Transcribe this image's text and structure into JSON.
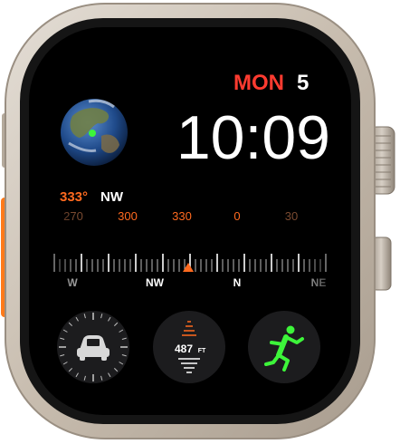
{
  "date": {
    "weekday": "MON",
    "day": "5"
  },
  "time": "10:09",
  "heading": {
    "degrees": "333°",
    "direction": "NW"
  },
  "compass_scale": {
    "degree_labels": [
      "270",
      "300",
      "330",
      "0",
      "30"
    ],
    "cardinal_labels": [
      "W",
      "NW",
      "N",
      "NE"
    ]
  },
  "elevation": {
    "value": "487",
    "unit": "FT"
  },
  "icons": {
    "globe": "earth-globe-icon",
    "car": "car-icon",
    "runner": "running-figure-icon"
  },
  "colors": {
    "accent_red": "#ff3b30",
    "accent_orange": "#ff6a1f",
    "activity_green": "#3df53a",
    "titanium": "#c9bfb3",
    "action_button": "#ff7a1a"
  }
}
